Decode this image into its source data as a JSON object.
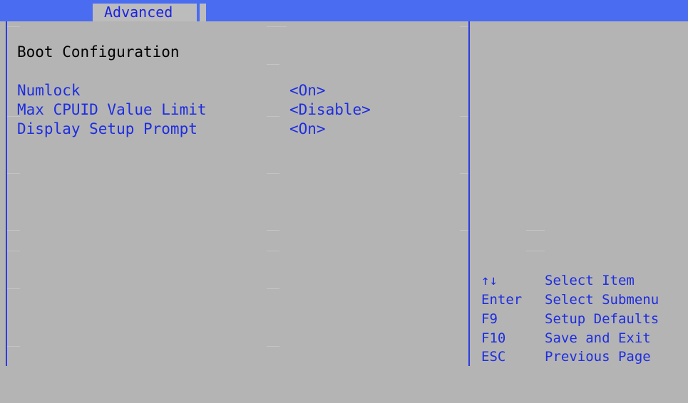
{
  "header": {
    "active_tab": "Advanced"
  },
  "page": {
    "section_title": "Boot Configuration"
  },
  "settings": [
    {
      "label": "Numlock",
      "value": "<On>"
    },
    {
      "label": "Max CPUID Value Limit",
      "value": "<Disable>"
    },
    {
      "label": "Display Setup Prompt",
      "value": "<On>"
    }
  ],
  "help": [
    {
      "key": "↑↓",
      "action": "Select Item"
    },
    {
      "key": "Enter",
      "action": "Select Submenu"
    },
    {
      "key": "F9",
      "action": "Setup Defaults"
    },
    {
      "key": "F10",
      "action": "Save and Exit"
    },
    {
      "key": "ESC",
      "action": "Previous Page"
    }
  ],
  "colors": {
    "background": "#b4b4b4",
    "topbar": "#4a6cf0",
    "text_blue": "#1e2de0",
    "border_blue": "#2b3ee0"
  }
}
